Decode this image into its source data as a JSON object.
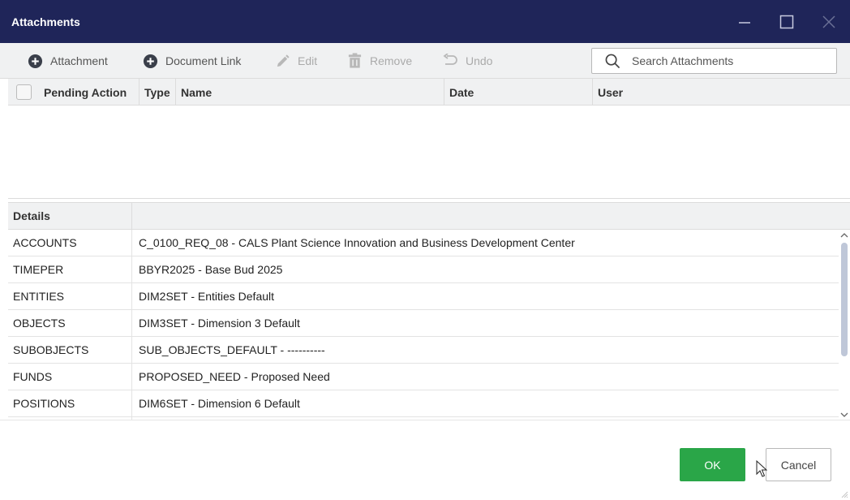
{
  "window": {
    "title": "Attachments"
  },
  "toolbar": {
    "attachment_label": "Attachment",
    "document_link_label": "Document Link",
    "edit_label": "Edit",
    "remove_label": "Remove",
    "undo_label": "Undo"
  },
  "search": {
    "placeholder": "Search Attachments",
    "value": ""
  },
  "attachments_grid": {
    "columns": [
      "Pending Action",
      "Type",
      "Name",
      "Date",
      "User"
    ],
    "rows": []
  },
  "details": {
    "header": "Details",
    "rows": [
      {
        "key": "ACCOUNTS",
        "value": "C_0100_REQ_08 - CALS Plant Science Innovation and Business Development Center"
      },
      {
        "key": "TIMEPER",
        "value": "BBYR2025 - Base Bud 2025"
      },
      {
        "key": "ENTITIES",
        "value": "DIM2SET - Entities Default"
      },
      {
        "key": "OBJECTS",
        "value": "DIM3SET - Dimension 3 Default"
      },
      {
        "key": "SUBOBJECTS",
        "value": "SUB_OBJECTS_DEFAULT - ----------"
      },
      {
        "key": "FUNDS",
        "value": "PROPOSED_NEED - Proposed Need"
      },
      {
        "key": "POSITIONS",
        "value": "DIM6SET - Dimension 6 Default"
      }
    ]
  },
  "footer": {
    "ok_label": "OK",
    "cancel_label": "Cancel"
  },
  "colors": {
    "titlebar": "#1f2559",
    "ok_button": "#2aa648",
    "toolbar_bg": "#f0f1f2"
  },
  "icons": {
    "add": "plus-circle-icon",
    "edit": "pencil-icon",
    "remove": "trash-icon",
    "undo": "undo-arrow-icon",
    "search": "search-icon"
  }
}
